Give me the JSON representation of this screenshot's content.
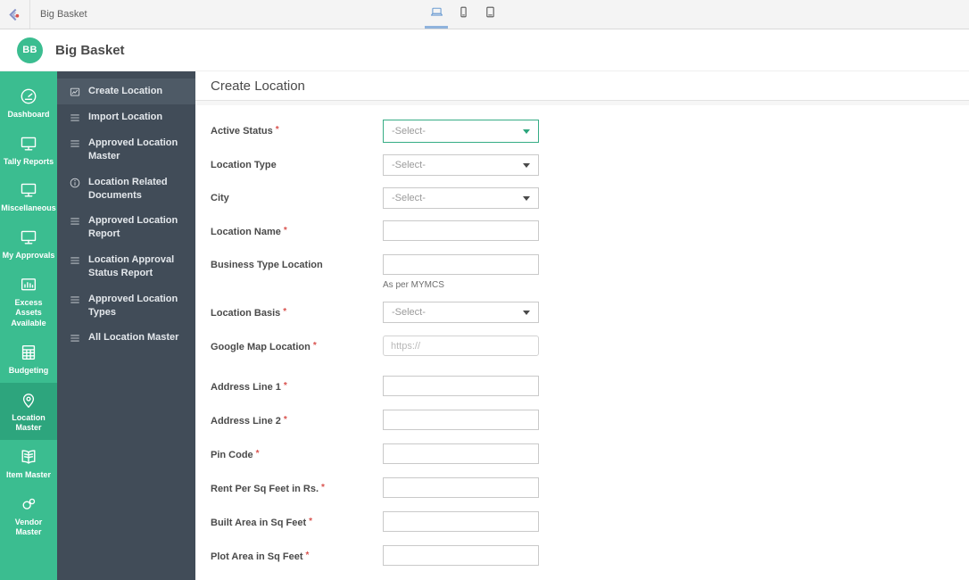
{
  "colors": {
    "accent_green": "#3bbd90",
    "accent_green_selected": "#2da57d",
    "sidebar_dark": "#414c58",
    "sidebar_dark_selected": "#4e5a66",
    "select_focus_border": "#36ad85",
    "required_red": "#d9534f",
    "device_active_blue": "#6b9bd2"
  },
  "topbar": {
    "app_title": "Big Basket",
    "logo_icon": "chevron-logo-icon",
    "devices": [
      {
        "icon": "laptop-icon",
        "active": true
      },
      {
        "icon": "phone-icon",
        "active": false
      },
      {
        "icon": "tablet-icon",
        "active": false
      }
    ]
  },
  "header": {
    "avatar_initials": "BB",
    "title": "Big Basket"
  },
  "sidebar": {
    "items": [
      {
        "label": "Dashboard",
        "icon": "gauge-icon",
        "selected": false
      },
      {
        "label": "Tally Reports",
        "icon": "monitor-icon",
        "selected": false
      },
      {
        "label": "Miscellaneous",
        "icon": "monitor-icon",
        "selected": false
      },
      {
        "label": "My Approvals",
        "icon": "monitor-icon",
        "selected": false
      },
      {
        "label": "Excess Assets Available",
        "icon": "chart-board-icon",
        "selected": false
      },
      {
        "label": "Budgeting",
        "icon": "spreadsheet-icon",
        "selected": false
      },
      {
        "label": "Location Master",
        "icon": "location-pin-icon",
        "selected": true
      },
      {
        "label": "Item Master",
        "icon": "book-icon",
        "selected": false
      },
      {
        "label": "Vendor Master",
        "icon": "vendor-icon",
        "selected": false
      }
    ]
  },
  "submenu": {
    "items": [
      {
        "label": "Create Location",
        "icon": "compose-icon",
        "selected": true
      },
      {
        "label": "Import Location",
        "icon": "list-icon",
        "selected": false
      },
      {
        "label": "Approved Location Master",
        "icon": "list-icon",
        "selected": false
      },
      {
        "label": "Location Related Documents",
        "icon": "info-icon",
        "selected": false
      },
      {
        "label": "Approved Location Report",
        "icon": "list-icon",
        "selected": false
      },
      {
        "label": "Location Approval Status Report",
        "icon": "list-icon",
        "selected": false
      },
      {
        "label": "Approved Location Types",
        "icon": "list-icon",
        "selected": false
      },
      {
        "label": "All Location Master",
        "icon": "list-icon",
        "selected": false
      }
    ]
  },
  "main": {
    "title": "Create Location",
    "form": {
      "required_marker": "*",
      "rows": [
        {
          "label": "Active Status",
          "required": true,
          "type": "select",
          "value": "-Select-",
          "focused": true
        },
        {
          "label": "Location Type",
          "required": false,
          "type": "select",
          "value": "-Select-"
        },
        {
          "label": "City",
          "required": false,
          "type": "select",
          "value": "-Select-"
        },
        {
          "label": "Location Name",
          "required": true,
          "type": "input",
          "value": "",
          "placeholder": ""
        },
        {
          "label": "Business Type Location",
          "required": false,
          "type": "input",
          "value": "",
          "placeholder": "",
          "helper": "As per MYMCS"
        },
        {
          "label": "Location Basis",
          "required": true,
          "type": "select",
          "value": "-Select-"
        },
        {
          "label": "Google Map Location",
          "required": true,
          "type": "input",
          "value": "",
          "placeholder": "https://",
          "rounded": true,
          "gap_after": true
        },
        {
          "label": "Address Line 1",
          "required": true,
          "type": "input",
          "value": "",
          "placeholder": ""
        },
        {
          "label": "Address Line 2",
          "required": true,
          "type": "input",
          "value": "",
          "placeholder": ""
        },
        {
          "label": "Pin Code",
          "required": true,
          "type": "input",
          "value": "",
          "placeholder": ""
        },
        {
          "label": "Rent Per Sq Feet in Rs.",
          "required": true,
          "type": "input",
          "value": "",
          "placeholder": ""
        },
        {
          "label": "Built Area in Sq Feet",
          "required": true,
          "type": "input",
          "value": "",
          "placeholder": ""
        },
        {
          "label": "Plot Area in Sq Feet",
          "required": true,
          "type": "input",
          "value": "",
          "placeholder": ""
        }
      ]
    }
  }
}
